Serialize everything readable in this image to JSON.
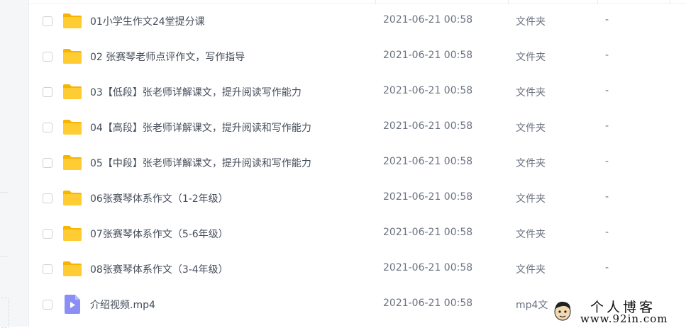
{
  "files": [
    {
      "name": "01小学生作文24堂提分课",
      "date": "2021-06-21 00:58",
      "type": "文件夹",
      "size": "-",
      "icon": "folder-icon"
    },
    {
      "name": "02 张赛琴老师点评作文，写作指导",
      "date": "2021-06-21 00:58",
      "type": "文件夹",
      "size": "-",
      "icon": "folder-icon"
    },
    {
      "name": "03【低段】张老师详解课文，提升阅读写作能力",
      "date": "2021-06-21 00:58",
      "type": "文件夹",
      "size": "-",
      "icon": "folder-icon"
    },
    {
      "name": "04【高段】张老师详解课文，提升阅读和写作能力",
      "date": "2021-06-21 00:58",
      "type": "文件夹",
      "size": "-",
      "icon": "folder-icon"
    },
    {
      "name": "05【中段】张老师详解课文，提升阅读和写作能力",
      "date": "2021-06-21 00:58",
      "type": "文件夹",
      "size": "-",
      "icon": "folder-icon"
    },
    {
      "name": "06张赛琴体系作文（1-2年级）",
      "date": "2021-06-21 00:58",
      "type": "文件夹",
      "size": "-",
      "icon": "folder-icon"
    },
    {
      "name": "07张赛琴体系作文（5-6年级）",
      "date": "2021-06-21 00:58",
      "type": "文件夹",
      "size": "-",
      "icon": "folder-icon"
    },
    {
      "name": "08张赛琴体系作文（3-4年级）",
      "date": "2021-06-21 00:58",
      "type": "文件夹",
      "size": "-",
      "icon": "folder-icon"
    },
    {
      "name": "介绍视频.mp4",
      "date": "2021-06-21 00:58",
      "type": "mp4文",
      "size": "",
      "icon": "video-file-icon"
    }
  ],
  "watermark": {
    "title": "个人博客",
    "url": "www.92in.com"
  },
  "colors": {
    "folder": "#ffcc33",
    "video_icon": "#8b8ff5",
    "text": "#454d5a",
    "muted": "#6b7280"
  }
}
